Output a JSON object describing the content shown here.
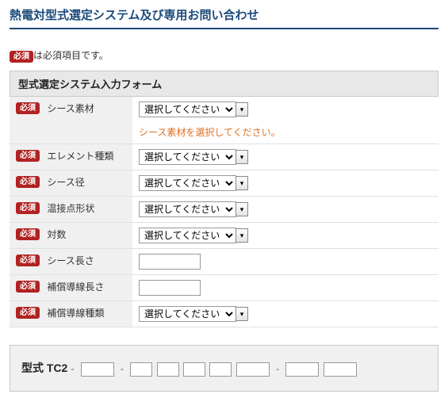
{
  "page_title": "熱電対型式選定システム及び専用お問い合わせ",
  "badges": {
    "required": "必須"
  },
  "required_note": "は必須項目です。",
  "form_header": "型式選定システム入力フォーム",
  "select_placeholder": "選択してください",
  "fields": {
    "sheath_material": {
      "label": "シース素材",
      "validation": "シース素材を選択してください。"
    },
    "element_type": {
      "label": "エレメント種類"
    },
    "sheath_diameter": {
      "label": "シース径"
    },
    "junction_shape": {
      "label": "温接点形状"
    },
    "pair_count": {
      "label": "対数"
    },
    "sheath_length": {
      "label": "シース長さ"
    },
    "leadwire_length": {
      "label": "補償導線長さ"
    },
    "leadwire_type": {
      "label": "補償導線種類"
    }
  },
  "result": {
    "label": "型式 TC2",
    "sep": "-"
  }
}
